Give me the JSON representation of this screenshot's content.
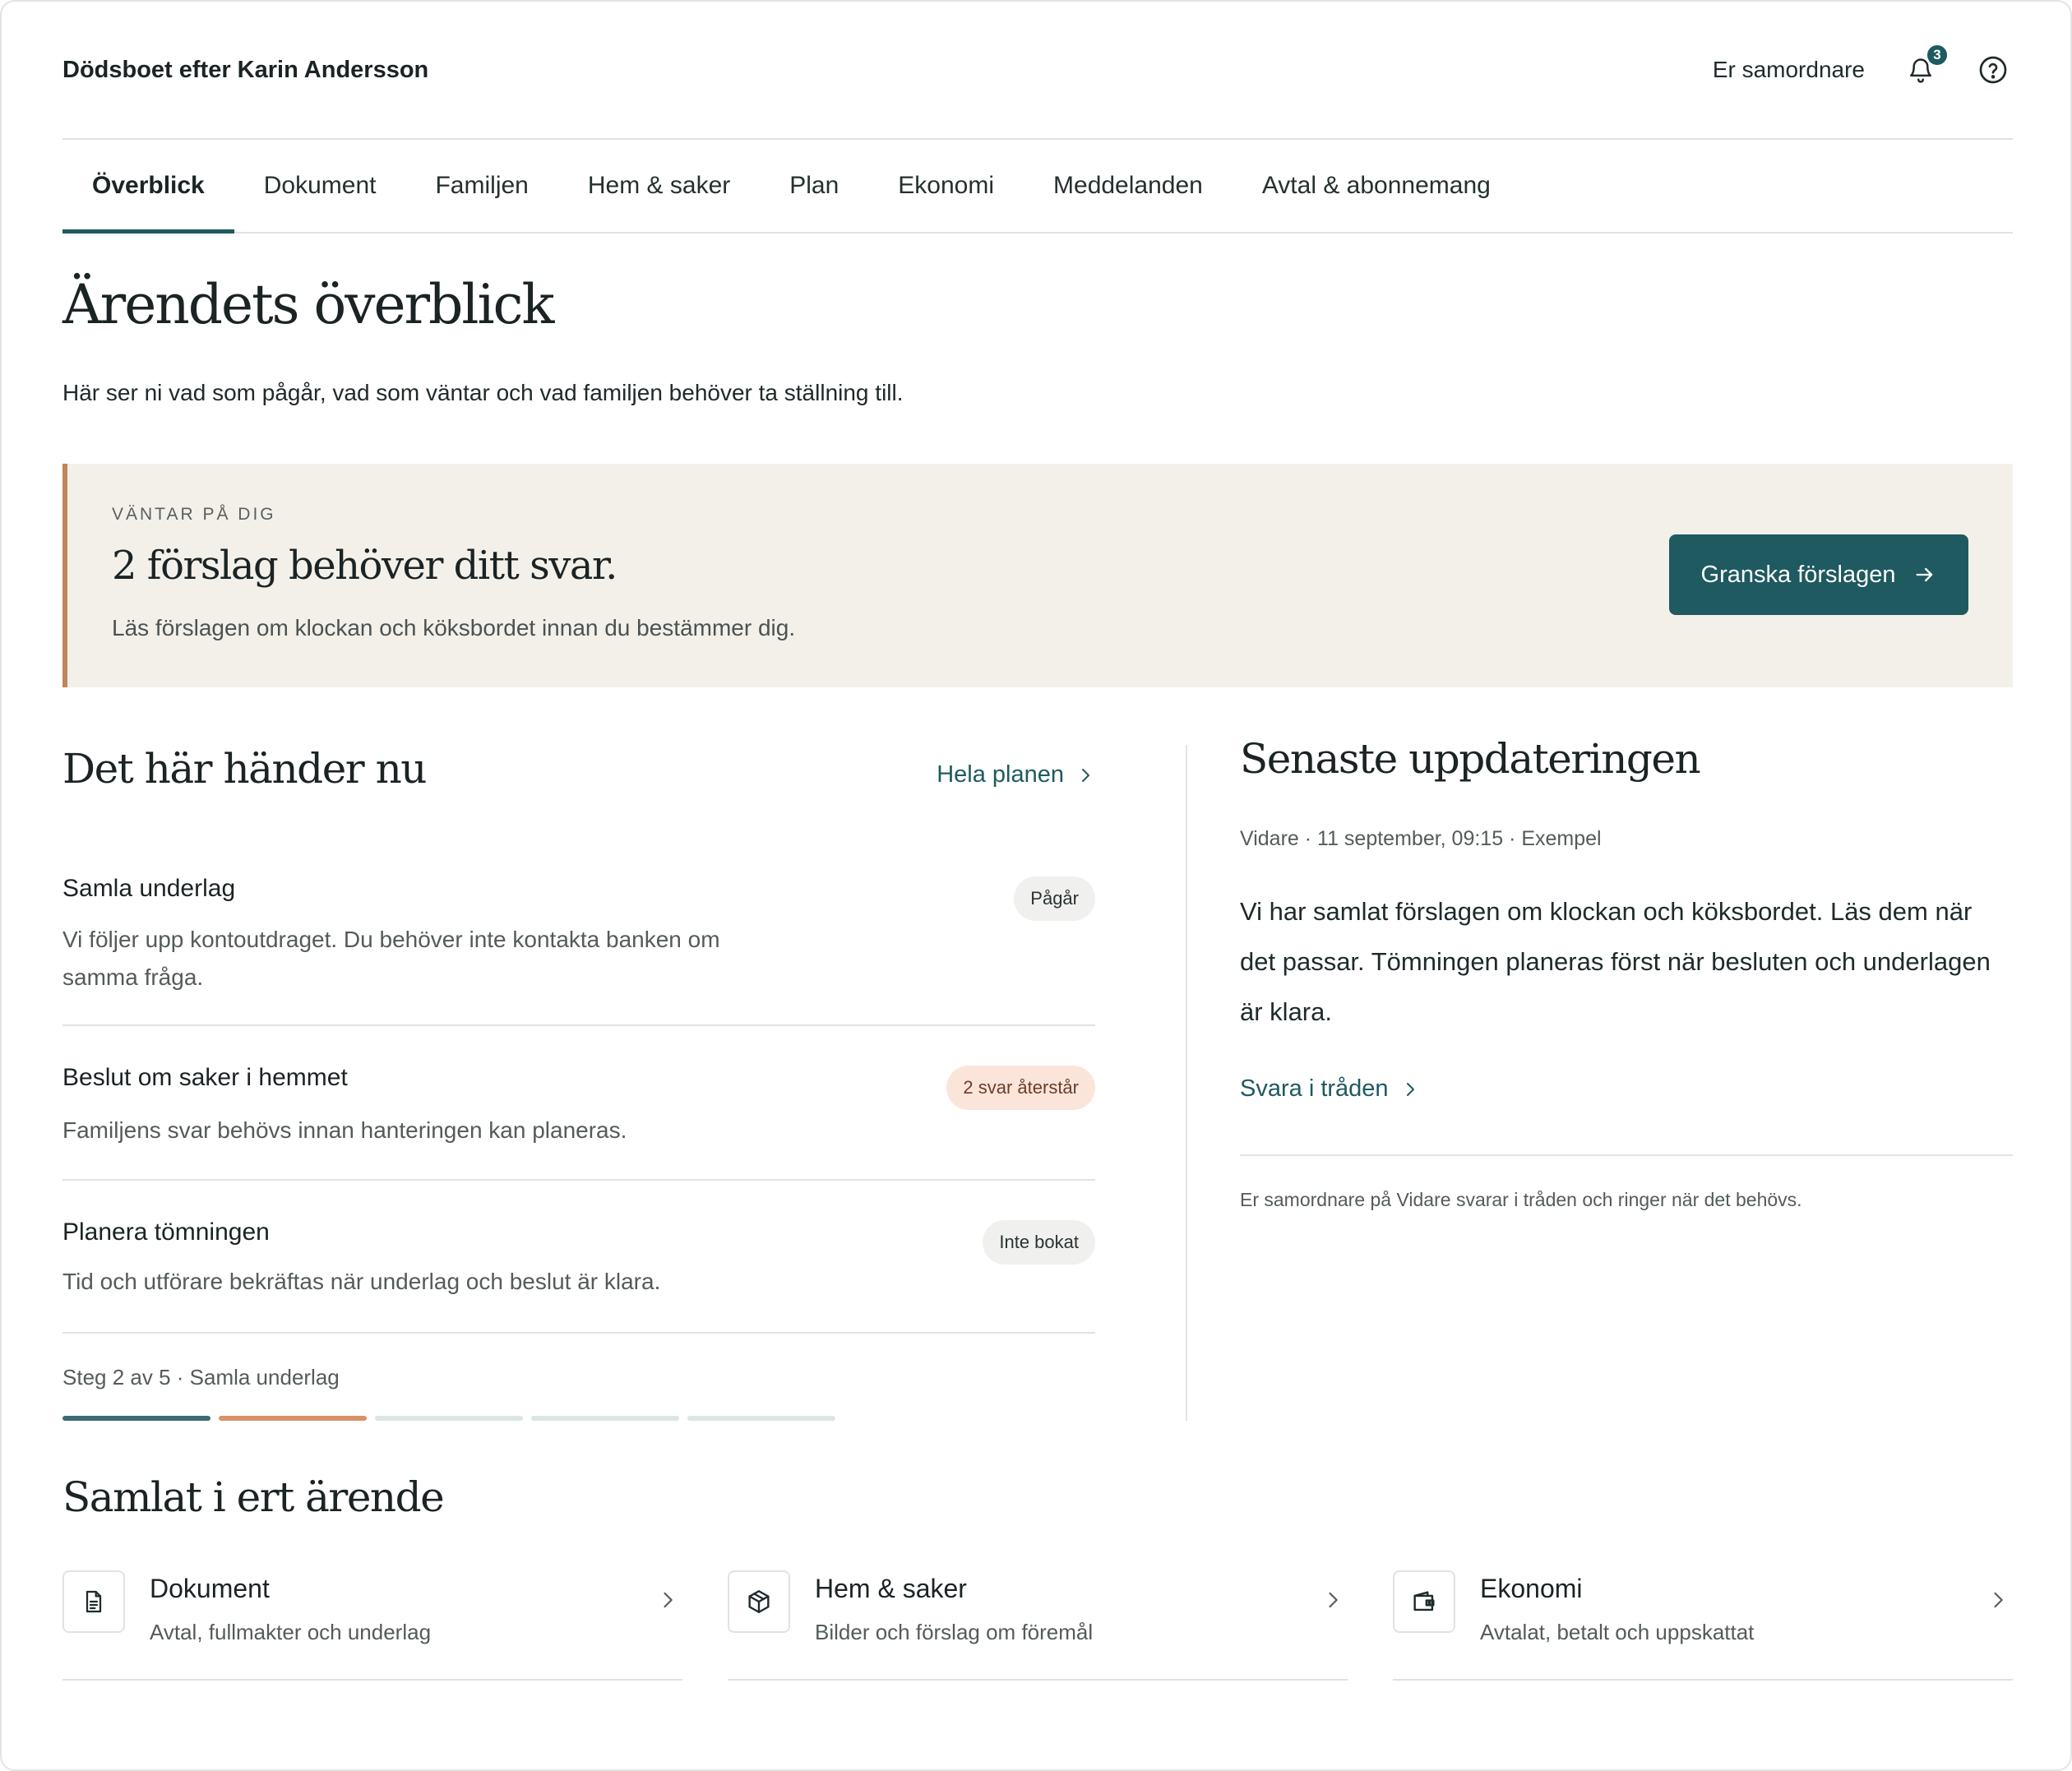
{
  "header": {
    "case_title": "Dödsboet efter Karin Andersson",
    "role_label": "Er samordnare",
    "notification_count": "3"
  },
  "tabs": [
    {
      "label": "Överblick",
      "active": true
    },
    {
      "label": "Dokument",
      "active": false
    },
    {
      "label": "Familjen",
      "active": false
    },
    {
      "label": "Hem & saker",
      "active": false
    },
    {
      "label": "Plan",
      "active": false
    },
    {
      "label": "Ekonomi",
      "active": false
    },
    {
      "label": "Meddelanden",
      "active": false
    },
    {
      "label": "Avtal & abonnemang",
      "active": false
    }
  ],
  "page": {
    "title": "Ärendets överblick",
    "subtitle": "Här ser ni vad som pågår, vad som väntar och vad familjen behöver ta ställning till."
  },
  "callout": {
    "kicker": "VÄNTAR PÅ DIG",
    "title": "2 förslag behöver ditt svar.",
    "text": "Läs förslagen om klockan och köksbordet innan du bestämmer dig.",
    "button_label": "Granska förslagen"
  },
  "now": {
    "title": "Det här händer nu",
    "plan_link": "Hela planen",
    "tasks": [
      {
        "title": "Samla underlag",
        "desc": "Vi följer upp kontoutdraget. Du behöver inte kontakta banken om samma fråga.",
        "status": "Pågår",
        "tone": "grey"
      },
      {
        "title": "Beslut om saker i hemmet",
        "desc": "Familjens svar behövs innan hanteringen kan planeras.",
        "status": "2 svar återstår",
        "tone": "peach"
      },
      {
        "title": "Planera tömningen",
        "desc": "Tid och utförare bekräftas när underlag och beslut är klara.",
        "status": "Inte bokat",
        "tone": "grey"
      }
    ],
    "steps_label": "Steg 2 av 5 · Samla underlag",
    "steps": {
      "current": 2,
      "total": 5
    },
    "step_colors": [
      "#3d6b72",
      "#d99168",
      "#dbe6e5",
      "#dbe6e5",
      "#dbe6e5"
    ]
  },
  "update": {
    "title": "Senaste uppdateringen",
    "meta": "Vidare · 11 september, 09:15 · Exempel",
    "body": "Vi har samlat förslagen om klockan och köksbordet. Läs dem när det passar. Tömningen planeras först när besluten och underlagen är klara.",
    "reply_link": "Svara i tråden",
    "foot_note": "Er samordnare på Vidare svarar i tråden och ringer när det behövs."
  },
  "collected": {
    "title": "Samlat i ert ärende",
    "cards": [
      {
        "title": "Dokument",
        "sub": "Avtal, fullmakter och underlag",
        "icon": "document-icon"
      },
      {
        "title": "Hem & saker",
        "sub": "Bilder och förslag om föremål",
        "icon": "box-icon"
      },
      {
        "title": "Ekonomi",
        "sub": "Avtalat, betalt och uppskattat",
        "icon": "wallet-icon"
      }
    ]
  },
  "colors": {
    "accent": "#1e5a60",
    "callout_border": "#c0855a",
    "callout_bg": "#f3f0ea"
  }
}
